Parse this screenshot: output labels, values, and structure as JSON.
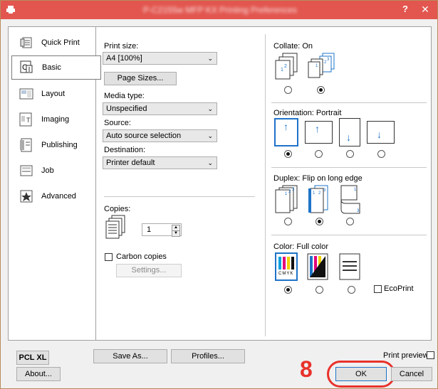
{
  "window": {
    "title": "P-C2155w MFP KX Printing Preferences",
    "help": "?",
    "close": "✕"
  },
  "nav": {
    "items": [
      {
        "label": "Quick Print"
      },
      {
        "label": "Basic"
      },
      {
        "label": "Layout"
      },
      {
        "label": "Imaging"
      },
      {
        "label": "Publishing"
      },
      {
        "label": "Job"
      },
      {
        "label": "Advanced"
      }
    ],
    "active": "Basic"
  },
  "basic": {
    "print_size_label": "Print size:",
    "print_size_value": "A4  [100%]",
    "page_sizes_button": "Page Sizes...",
    "media_type_label": "Media type:",
    "media_type_value": "Unspecified",
    "source_label": "Source:",
    "source_value": "Auto source selection",
    "destination_label": "Destination:",
    "destination_value": "Printer default",
    "copies_label": "Copies:",
    "copies_value": "1",
    "carbon_copies_label": "Carbon copies",
    "settings_button": "Settings..."
  },
  "right": {
    "collate_label": "Collate:  On",
    "orientation_label": "Orientation:  Portrait",
    "duplex_label": "Duplex:  Flip on long edge",
    "color_label": "Color:  Full color",
    "ecoprint_label": "EcoPrint",
    "cmyk": "CMYK"
  },
  "footer": {
    "pcl_button": "PCL XL",
    "save_as_button": "Save As...",
    "profiles_button": "Profiles...",
    "print_preview_label": "Print preview",
    "about_button": "About...",
    "ok_button": "OK",
    "cancel_button": "Cancel",
    "step_number": "8"
  },
  "colors": {
    "titlebar": "#e2564f",
    "highlight": "#e8322b",
    "accent_blue": "#1e73c8"
  }
}
